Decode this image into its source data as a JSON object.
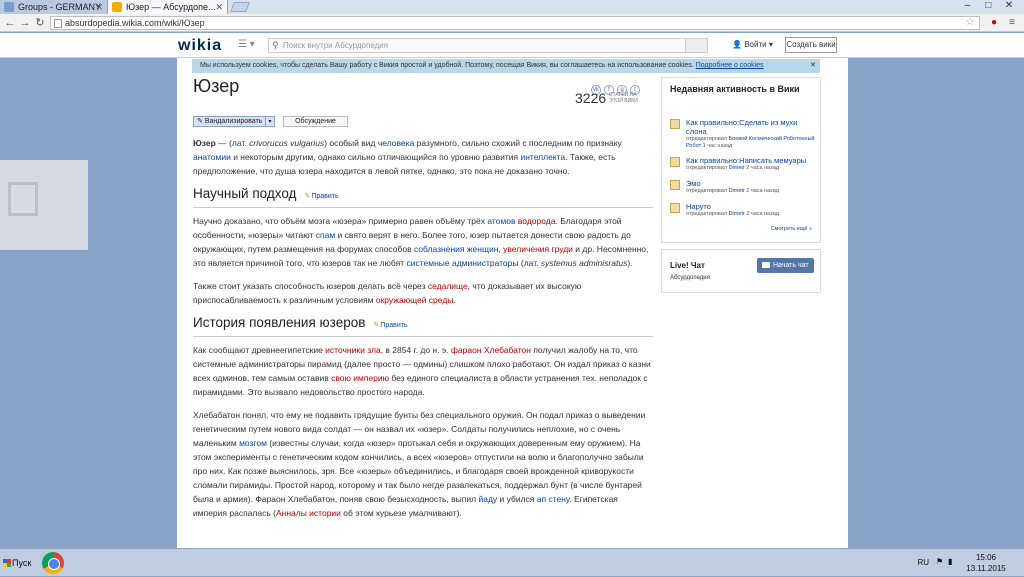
{
  "browser": {
    "tabs": [
      {
        "label": "Groups - GERMANY"
      },
      {
        "label": "Юзер — Абсурдопе..."
      }
    ],
    "url": "absurdopedia.wikia.com/wiki/Юзер",
    "window_controls": [
      "–",
      "□",
      "✕"
    ]
  },
  "wikia_header": {
    "logo": "wikia",
    "search_placeholder": "Поиск внутри Абсурдопедия",
    "login": "Войти",
    "create_wiki": "Создать вики"
  },
  "cookie_notice": {
    "text": "Мы используем cookies, чтобы сделать Вашу работу с Викия простой и удобной. Поэтому, посещая Викия, вы соглашаетесь на использование cookies.",
    "link": "Подробнее о cookies",
    "close": "✕"
  },
  "article": {
    "title": "Юзер",
    "article_count": "3226",
    "article_count_label": "СТАТЕЙ НА ЭТОЙ ВИКИ",
    "social": [
      "vk",
      "f",
      "g",
      "t"
    ],
    "edit_button": "Вандализировать",
    "talk_button": "Обсуждение",
    "section_edit": "Править",
    "intro": {
      "t1": "Юзер",
      "t2": " — (",
      "t3": "лат.",
      "t4": " crivorucus vulgarius",
      "t5": ") особый вид ",
      "l1": "человека",
      "t6": " разумного, сильно схожий с последним по признаку ",
      "l2": "анатомии",
      "t7": " и некоторым другим, однако сильно отличающийся по уровню развития ",
      "l3": "интеллекта",
      "t8": ". Также, есть предположение, что душа юзера находится в левой пятке, однако, это пока не доказано точно."
    },
    "section1": {
      "heading": "Научный подход",
      "p1": {
        "t1": "Научно доказано, что объём мозга «юзера» примерно равен объёму трёх ",
        "l1": "атомов",
        "t2": " ",
        "l2": "водорода",
        "t3": ". Благодаря этой особенности, «юзеры» читают ",
        "l3": "спам",
        "t4": " и свято верят в него. Более того, юзер пытается донести свою радость до окружающих, путем размещения на форумах способов ",
        "l4": "соблазнения женщин",
        "t5": ", ",
        "l5": "увеличения груди",
        "t6": " и др. Несомненно, это является причиной того, что юзеров так не любят ",
        "l6": "системные администраторы",
        "t7": " (",
        "l7": "лат.",
        "t8": " systemus adminisratus",
        "t9": ")."
      },
      "p2": {
        "t1": "Также стоит указать способность юзеров делать всё через ",
        "l1": "седалище",
        "t2": ", что доказывает их высокую приспосабливаемость к различным условиям ",
        "l2": "окружающей среды",
        "t3": "."
      }
    },
    "section2": {
      "heading": "История появления юзеров",
      "p1": {
        "t1": "Как сообщают древнеегипетские ",
        "l1": "источники зла",
        "t2": ", в 2854 г. до н. э. ",
        "l2": "фараон Хлебабатон",
        "t3": " получил жалобу на то, что системные администраторы пирамид (далее просто — одмины) слишком плохо работают. Он издал приказ о казни всех одминов, тем самым оставив ",
        "l3": "свою империю",
        "t4": " без единого специалиста в области устранения тех. неполадок с пирамидами. Это вызвало недовольство простого народа."
      },
      "p2": {
        "t1": "Хлебабатон понял, что ему не подавить грядущие бунты без специального оружия. Он подал приказ о выведении генетическим путем нового вида солдат — он назвал их «юзер». Солдаты получились неплохие, но с очень маленьким ",
        "l1": "мозгом",
        "t2": " (известны случаи, когда «юзер» протыкал себя и окружающих доверенным ему оружием). На этом эксперименты с генетическим кодом кончились, а всех «юзеров» отпустили на волю и благополучно забыли про них. Как позже выяснилось, зря. Все «юзеры» объединились, и благодаря своей врожденной криворукости сломали пирамиды. Простой народ, которому и так было негде развлекаться, поддержал бунт (в числе бунтарей была и армия). Фараон Хлебабатон, поняв свою безысходность, выпил ",
        "l2": "йаду",
        "t3": " и убился ",
        "l3": "ап стену",
        "t4": ". Египетская империя распалась (",
        "l4": "Анналы истории",
        "t5": " об этом курьезе умалчивают)."
      }
    }
  },
  "rail": {
    "activity_title": "Недавняя активность в Вики",
    "items": [
      {
        "title": "Как правильно:Сделать из мухи слона",
        "meta1": "отредактировал ",
        "user": "Боевой Космический Роботонный Робот",
        "meta2": " 1 час назад"
      },
      {
        "title": "Как правильно:Написать мемуары",
        "meta1": "отредактировал ",
        "user": "Dimetr",
        "meta2": " 2 часа назад"
      },
      {
        "title": "Эмо",
        "meta1": "отредактировал ",
        "user": "Dimetr",
        "meta2": " 2 часа назад"
      },
      {
        "title": "Наруто",
        "meta1": "отредактировал ",
        "user": "Dimetr",
        "meta2": " 2 часа назад"
      }
    ],
    "see_more": "Смотреть ещё »",
    "chat_title": "Live! Чат",
    "chat_subtitle": "Абсурдопедия",
    "chat_button": "Начать чат"
  },
  "taskbar": {
    "start": "Пуск",
    "lang": "RU",
    "time": "15:06",
    "date": "13.11.2015"
  }
}
